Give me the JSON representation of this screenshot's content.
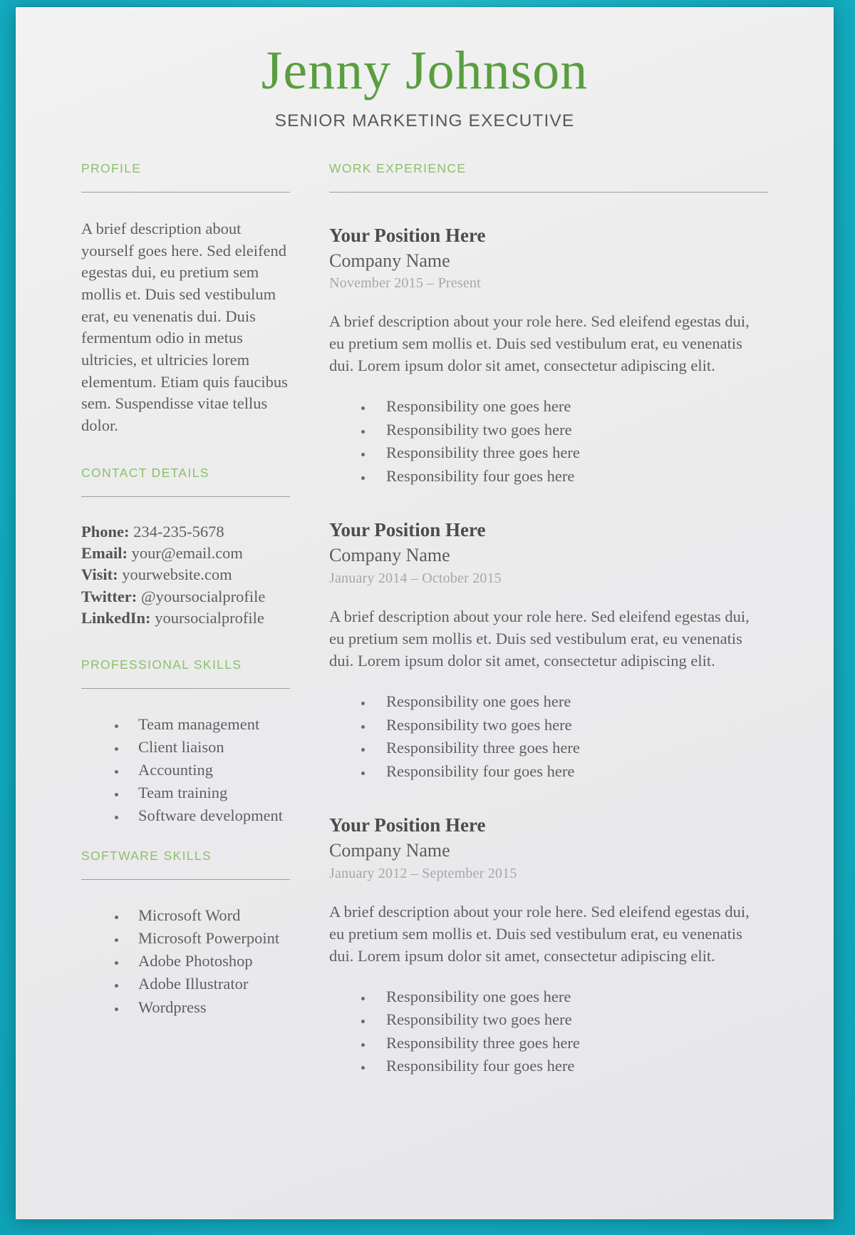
{
  "theme": {
    "background_teal": "#16b4c8",
    "paper": "#ececed",
    "name_green": "#5a9e3f",
    "heading_green": "#8cc06b",
    "body_gray": "#5e5f61",
    "date_gray": "#a6a7a9",
    "rule_gray": "#9d9d9f"
  },
  "header": {
    "name": "Jenny Johnson",
    "subtitle": "SENIOR MARKETING EXECUTIVE"
  },
  "left_column": {
    "profile": {
      "heading": "PROFILE",
      "text": "A brief description about yourself goes here. Sed eleifend egestas dui, eu pretium sem mollis et. Duis sed vestibulum erat, eu venenatis dui. Duis fermentum odio in metus ultricies, et ultricies lorem elementum. Etiam quis faucibus sem. Suspendisse vitae tellus dolor."
    },
    "contact": {
      "heading": "CONTACT DETAILS",
      "items": [
        {
          "label": "Phone:",
          "value": "234-235-5678"
        },
        {
          "label": "Email:",
          "value": "your@email.com"
        },
        {
          "label": "Visit:",
          "value": " yourwebsite.com"
        },
        {
          "label": "Twitter:",
          "value": "@yoursocialprofile"
        },
        {
          "label": "LinkedIn:",
          "value": "yoursocialprofile"
        }
      ]
    },
    "professional_skills": {
      "heading": "PROFESSIONAL SKILLS",
      "items": [
        "Team management",
        "Client liaison",
        "Accounting",
        "Team training",
        "Software development"
      ]
    },
    "software_skills": {
      "heading": "SOFTWARE SKILLS",
      "items": [
        "Microsoft Word",
        "Microsoft Powerpoint",
        "Adobe Photoshop",
        "Adobe Illustrator",
        "Wordpress"
      ]
    }
  },
  "right_column": {
    "work_experience": {
      "heading": "WORK EXPERIENCE",
      "jobs": [
        {
          "title": "Your Position Here",
          "company": "Company Name",
          "dates": "November 2015 – Present",
          "description": "A brief description about your role here. Sed eleifend egestas dui, eu pretium sem mollis et. Duis sed vestibulum erat, eu venenatis dui. Lorem ipsum dolor sit amet, consectetur adipiscing elit.",
          "responsibilities": [
            "Responsibility one goes here",
            "Responsibility two goes here",
            "Responsibility three goes here",
            "Responsibility four goes here"
          ]
        },
        {
          "title": "Your Position Here",
          "company": "Company Name",
          "dates": "January 2014 – October 2015",
          "description": "A brief description about your role here. Sed eleifend egestas dui, eu pretium sem mollis et. Duis sed vestibulum erat, eu venenatis dui. Lorem ipsum dolor sit amet, consectetur adipiscing elit.",
          "responsibilities": [
            "Responsibility one goes here",
            "Responsibility two goes here",
            "Responsibility three goes here",
            "Responsibility four goes here"
          ]
        },
        {
          "title": "Your Position Here",
          "company": "Company Name",
          "dates": "January 2012 – September 2015",
          "description": "A brief description about your role here. Sed eleifend egestas dui, eu pretium sem mollis et. Duis sed vestibulum erat, eu venenatis dui. Lorem ipsum dolor sit amet, consectetur adipiscing elit.",
          "responsibilities": [
            "Responsibility one goes here",
            "Responsibility two goes here",
            "Responsibility three goes here",
            "Responsibility four goes here"
          ]
        }
      ]
    }
  }
}
